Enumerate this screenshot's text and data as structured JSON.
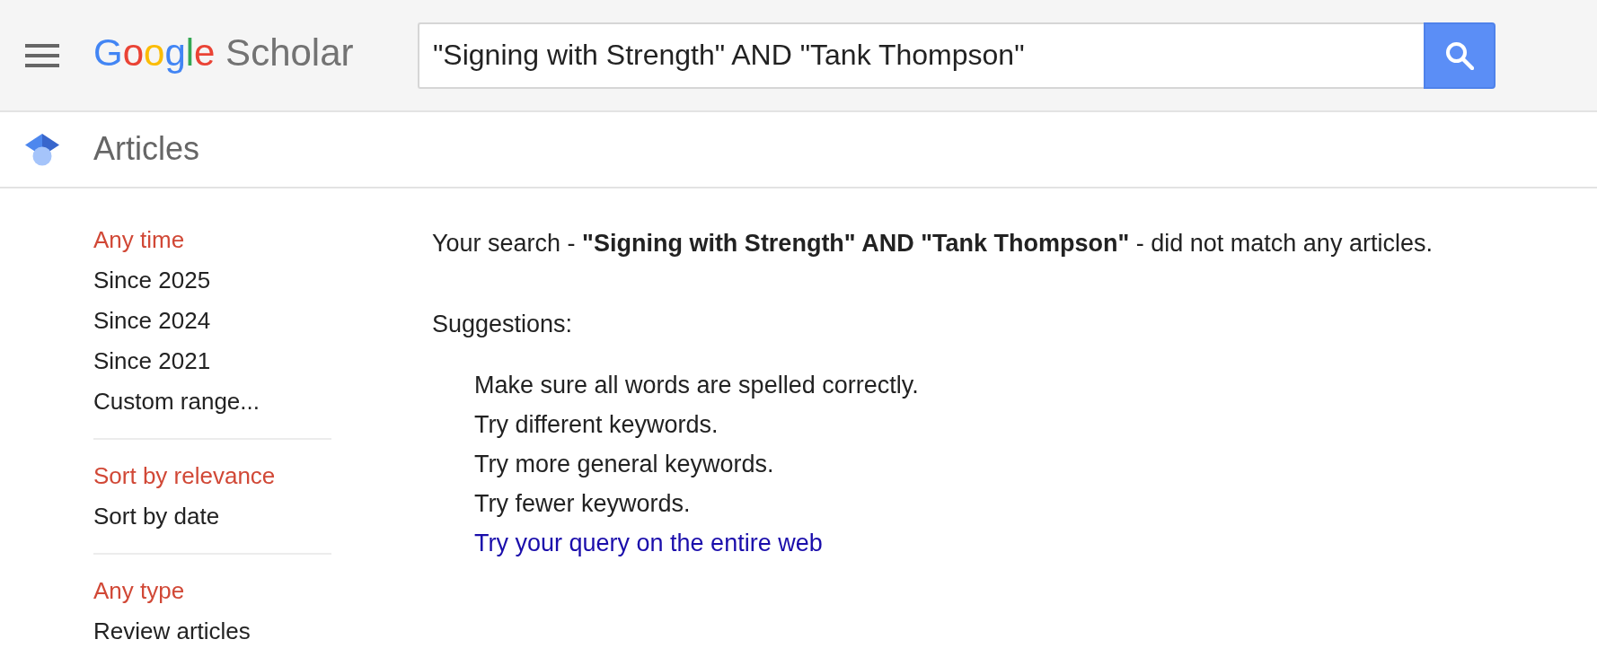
{
  "header": {
    "logo": {
      "brand": "Google",
      "product": "Scholar"
    },
    "search": {
      "value": "\"Signing with Strength\" AND \"Tank Thompson\""
    }
  },
  "section_bar": {
    "title": "Articles"
  },
  "sidebar": {
    "groups": [
      {
        "items": [
          {
            "label": "Any time",
            "selected": true
          },
          {
            "label": "Since 2025",
            "selected": false
          },
          {
            "label": "Since 2024",
            "selected": false
          },
          {
            "label": "Since 2021",
            "selected": false
          },
          {
            "label": "Custom range...",
            "selected": false
          }
        ]
      },
      {
        "items": [
          {
            "label": "Sort by relevance",
            "selected": true
          },
          {
            "label": "Sort by date",
            "selected": false
          }
        ]
      },
      {
        "items": [
          {
            "label": "Any type",
            "selected": true
          },
          {
            "label": "Review articles",
            "selected": false
          }
        ]
      }
    ]
  },
  "results": {
    "message": "Your search - **\"Signing with Strength\" AND \"Tank Thompson\"** - did not match any articles.",
    "suggestions_title": "Suggestions:",
    "suggestions": [
      {
        "kind": "text",
        "text": "Make sure all words are spelled correctly."
      },
      {
        "kind": "text",
        "text": "Try different keywords."
      },
      {
        "kind": "text",
        "text": "Try more general keywords."
      },
      {
        "kind": "text",
        "text": "Try fewer keywords."
      },
      {
        "kind": "link",
        "text": "Try your query on the entire web"
      }
    ]
  }
}
